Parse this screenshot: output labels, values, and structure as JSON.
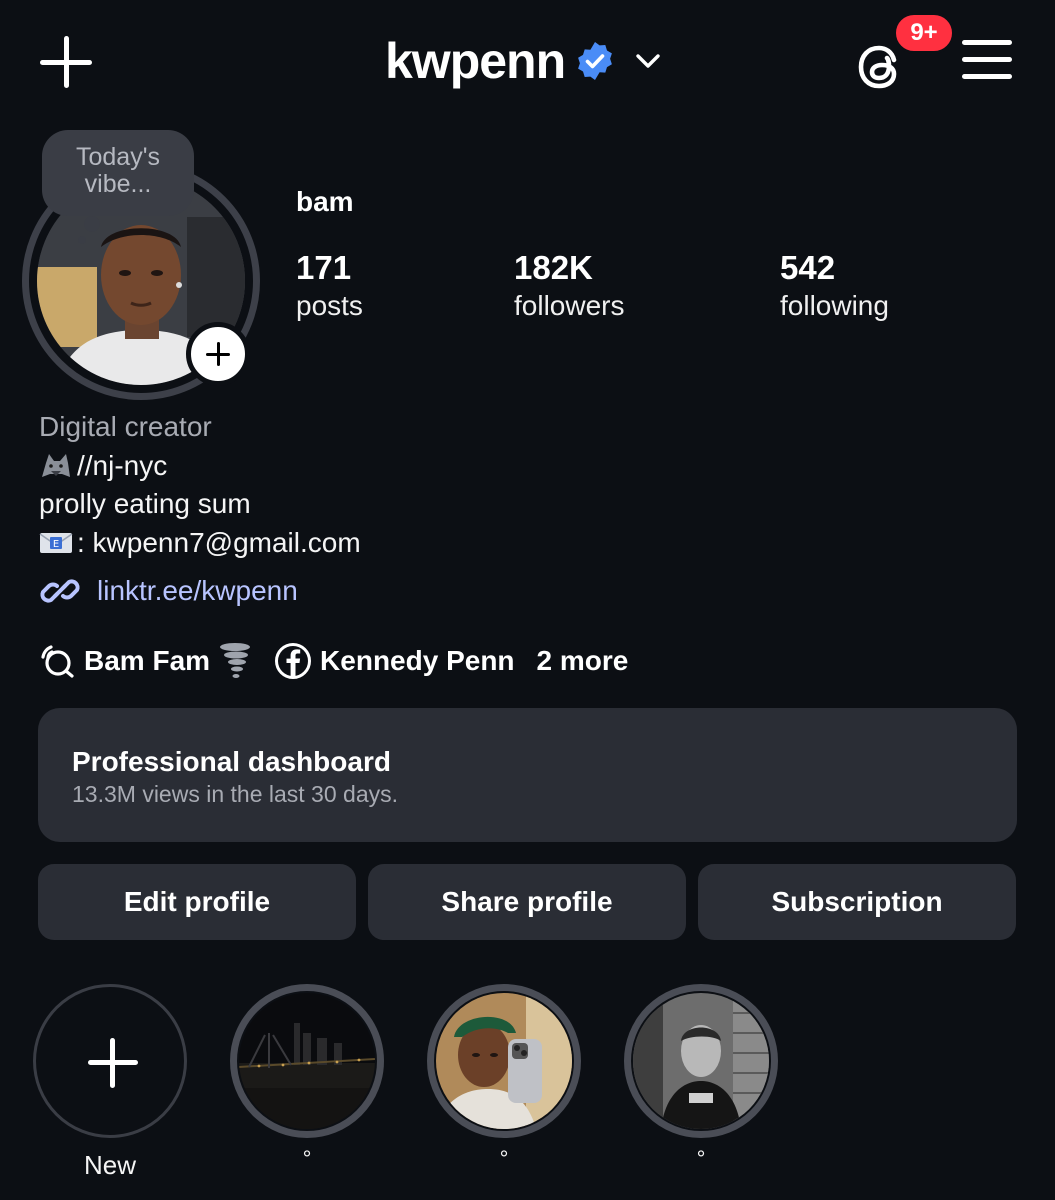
{
  "header": {
    "username": "kwpenn",
    "notification_badge": "9+"
  },
  "profile": {
    "note": "Today's vibe...",
    "display_name": "bam",
    "stats": [
      {
        "value": "171",
        "label": "posts"
      },
      {
        "value": "182K",
        "label": "followers"
      },
      {
        "value": "542",
        "label": "following"
      }
    ],
    "bio": {
      "category": "Digital creator",
      "line1": "//nj-nyc",
      "line2": "prolly eating sum",
      "line3": ": kwpenn7@gmail.com"
    },
    "link": "linktr.ee/kwpenn",
    "socials": {
      "broadcast": "Bam Fam",
      "facebook": "Kennedy Penn",
      "more": "2 more"
    }
  },
  "dashboard": {
    "title": "Professional dashboard",
    "subtitle": "13.3M views in the last 30 days."
  },
  "buttons": {
    "edit": "Edit profile",
    "share": "Share profile",
    "subscription": "Subscription"
  },
  "highlights": [
    {
      "label": "New"
    },
    {
      "label": "°"
    },
    {
      "label": "°"
    },
    {
      "label": "°"
    }
  ],
  "colors": {
    "background": "#0c0f14",
    "card": "#2a2d35",
    "link": "#b8c4ff",
    "verified": "#4a8cf7",
    "badge": "#ff3040"
  },
  "icons": [
    "plus-icon",
    "verified-icon",
    "chevron-down-icon",
    "threads-icon",
    "menu-icon",
    "link-icon",
    "broadcast-channel-icon",
    "facebook-icon",
    "tornado-emoji",
    "wolf-emoji",
    "envelope-emoji"
  ]
}
